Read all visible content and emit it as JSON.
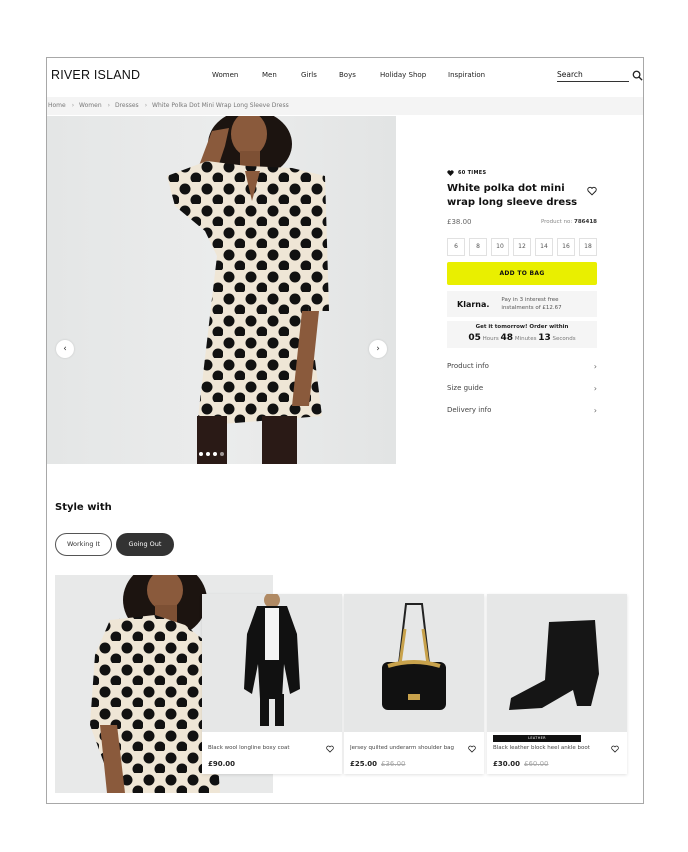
{
  "header": {
    "logo": "RIVER ISLAND",
    "nav": [
      "Women",
      "Men",
      "Girls",
      "Boys",
      "Holiday Shop",
      "Inspiration"
    ],
    "search_placeholder": "Search"
  },
  "breadcrumb": [
    "Home",
    "Women",
    "Dresses",
    "White Polka Dot Mini Wrap Long Sleeve Dress"
  ],
  "gallery": {
    "prev_icon": "‹",
    "next_icon": "›",
    "slides": 4,
    "active_slide": 1
  },
  "product": {
    "likes_label": "60 TIMES",
    "title": "White polka dot mini wrap long sleeve dress",
    "price": "£38.00",
    "product_no_label": "Product no:",
    "product_no": "786418",
    "sizes": [
      "6",
      "8",
      "10",
      "12",
      "14",
      "16",
      "18"
    ],
    "add_to_bag": "ADD TO BAG",
    "klarna": {
      "logo": "Klarna.",
      "line1": "Pay in 3 interest free",
      "line2": "instalments of £12.67"
    },
    "delivery": {
      "heading": "Get it tomorrow! Order within",
      "hours": "05",
      "hours_label": "Hours",
      "minutes": "48",
      "minutes_label": "Minutes",
      "seconds": "13",
      "seconds_label": "Seconds"
    },
    "accordion": [
      "Product info",
      "Size guide",
      "Delivery info"
    ]
  },
  "style_with": {
    "heading": "Style with",
    "tabs": [
      {
        "label": "Working It",
        "active": false
      },
      {
        "label": "Going Out",
        "active": true
      }
    ],
    "items": [
      {
        "name": "Black wool longline boxy coat",
        "price": "£90.00",
        "was": "",
        "tag": ""
      },
      {
        "name": "Jersey quilted underarm shoulder bag",
        "price": "£25.00",
        "was": "£36.00",
        "tag": ""
      },
      {
        "name": "Black leather block heel ankle boot",
        "price": "£30.00",
        "was": "£60.00",
        "tag": "LEATHER"
      }
    ]
  },
  "colors": {
    "add_to_bag_bg": "#e9ef00",
    "active_pill_bg": "#333333",
    "panel_bg": "#f5f5f5"
  }
}
